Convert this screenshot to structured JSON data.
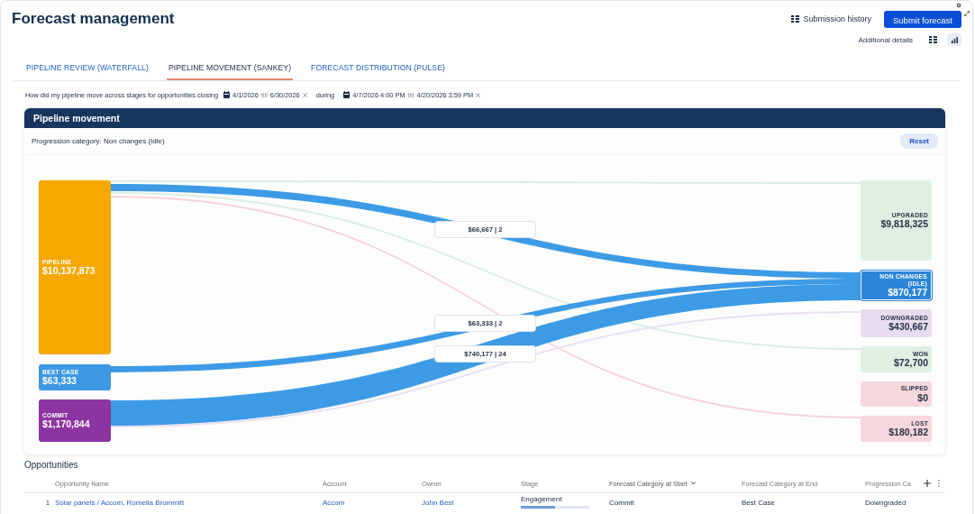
{
  "page": {
    "title": "Forecast management"
  },
  "actions": [
    {
      "kind": "link",
      "label": "Submission history"
    },
    {
      "kind": "primary",
      "label": "Submit forecast"
    }
  ],
  "view_switch": {
    "label": "Additional details",
    "options": [
      {
        "kind": "grid",
        "selected": false
      },
      {
        "kind": "chart",
        "selected": true
      }
    ]
  },
  "tabs": [
    {
      "label": "PIPELINE REVIEW (WATERFALL)",
      "selected": false
    },
    {
      "label": "PIPELINE MOVEMENT (SANKEY)",
      "selected": true
    },
    {
      "label": "FORECAST DISTRIBUTION (PULSE)",
      "selected": false
    }
  ],
  "filter": {
    "question": "How did my pipeline move across stages for opportunities closing",
    "close_range": {
      "from": "4/1/2026",
      "till_word": "till",
      "to": "6/30/2026"
    },
    "during_word": "during",
    "during_range": {
      "from": "4/7/2026 4:00 PM",
      "till_word": "till",
      "to": "4/20/2026 3:59 PM"
    }
  },
  "panel": {
    "title": "Pipeline movement",
    "subtitle": "Progression category: Non changes (Idle)",
    "reset_label": "Reset"
  },
  "sankey": {
    "sources": [
      {
        "label": "PIPELINE",
        "value": "$10,137,873",
        "color": "#f5a800"
      },
      {
        "label": "BEST CASE",
        "value": "$63,333",
        "color": "#3d97e3"
      },
      {
        "label": "COMMIT",
        "value": "$1,170,844",
        "color": "#8c34a0"
      }
    ],
    "targets": [
      {
        "label": "UPGRADED",
        "value": "$9,818,325",
        "color": "#ddf0e2",
        "selected": false
      },
      {
        "label": "NON CHANGES (IDLE)",
        "value": "$870,177",
        "color": "#2b84d8",
        "selected": true
      },
      {
        "label": "DOWNGRADED",
        "value": "$430,667",
        "color": "#e9dcef",
        "selected": false
      },
      {
        "label": "WON",
        "value": "$72,700",
        "color": "#ddf0e2",
        "selected": false
      },
      {
        "label": "SLIPPED",
        "value": "$0",
        "color": "#f8d7dc",
        "selected": false
      },
      {
        "label": "LOST",
        "value": "$180,182",
        "color": "#f8d7dc",
        "selected": false
      }
    ],
    "flows": [
      {
        "label": "$66,667 | 2",
        "color": "#3d9be6"
      },
      {
        "label": "$63,333 | 2",
        "color": "#3d9be6"
      },
      {
        "label": "$740,177 | 24",
        "color": "#3d9be6"
      },
      {
        "color": "#d9eee0"
      },
      {
        "color": "#d9eee0"
      },
      {
        "color": "#f6d3d9"
      },
      {
        "color": "#ecdff2"
      }
    ]
  },
  "opportunities": {
    "title": "Opportunities",
    "columns": [
      {
        "label": "Opportunity Name",
        "sorted": false
      },
      {
        "label": "Account",
        "sorted": false
      },
      {
        "label": "Owner",
        "sorted": false
      },
      {
        "label": "Stage",
        "sorted": false
      },
      {
        "label": "Forecast Category at Start",
        "sorted": true
      },
      {
        "label": "Forecast Category at End",
        "sorted": false
      },
      {
        "label": "Progression Ca",
        "sorted": false
      }
    ],
    "rows": [
      {
        "number": "1",
        "name": "Solar panels / Accom, Romelia Brummitt",
        "account": "Accom",
        "owner": "John Best",
        "stage": "Engagement",
        "level": 0.5,
        "start": "Commit",
        "end": "Best Case",
        "progression": "Downgraded"
      }
    ]
  }
}
